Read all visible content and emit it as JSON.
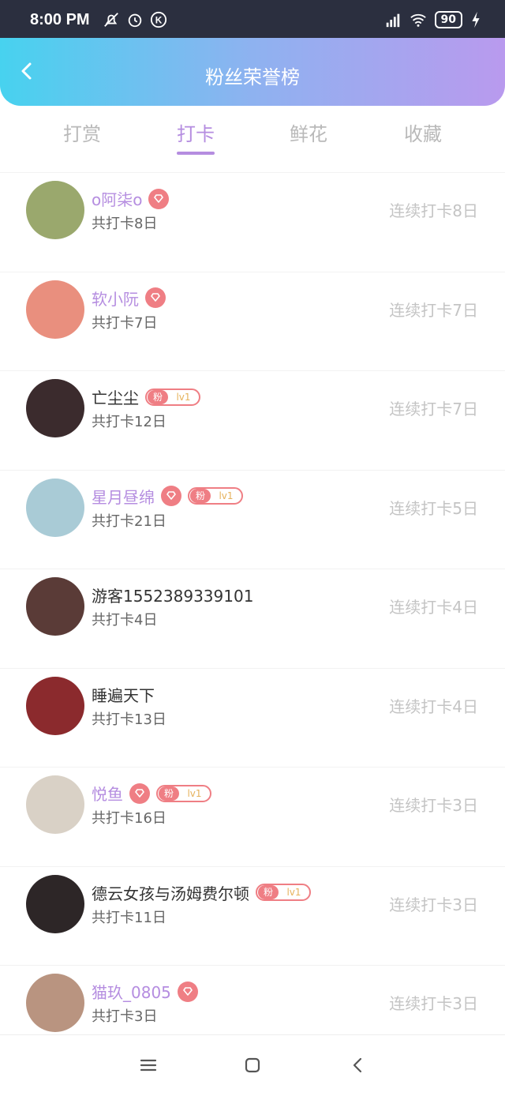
{
  "status": {
    "time": "8:00 PM",
    "battery": "90"
  },
  "header": {
    "title": "粉丝荣誉榜"
  },
  "tabs": [
    {
      "label": "打赏",
      "active": false
    },
    {
      "label": "打卡",
      "active": true
    },
    {
      "label": "鲜花",
      "active": false
    },
    {
      "label": "收藏",
      "active": false
    }
  ],
  "entries": [
    {
      "name": "o阿柒o",
      "purple": true,
      "diamond": true,
      "fan_badge": null,
      "total": "共打卡8日",
      "streak": "连续打卡8日",
      "avatar_color": "#9aa86d"
    },
    {
      "name": "软小阮",
      "purple": true,
      "diamond": true,
      "fan_badge": null,
      "total": "共打卡7日",
      "streak": "连续打卡7日",
      "avatar_color": "#e98f7e"
    },
    {
      "name": "亡尘尘",
      "purple": false,
      "diamond": false,
      "fan_badge": {
        "fan": "粉",
        "lv": "lv1"
      },
      "total": "共打卡12日",
      "streak": "连续打卡7日",
      "avatar_color": "#3b2b2d"
    },
    {
      "name": "星月昼绵",
      "purple": true,
      "diamond": true,
      "fan_badge": {
        "fan": "粉",
        "lv": "lv1"
      },
      "total": "共打卡21日",
      "streak": "连续打卡5日",
      "avatar_color": "#a9cbd6"
    },
    {
      "name": "游客1552389339101",
      "purple": false,
      "diamond": false,
      "fan_badge": null,
      "total": "共打卡4日",
      "streak": "连续打卡4日",
      "avatar_color": "#5a3b37"
    },
    {
      "name": "睡遍天下",
      "purple": false,
      "diamond": false,
      "fan_badge": null,
      "total": "共打卡13日",
      "streak": "连续打卡4日",
      "avatar_color": "#8b2a2d"
    },
    {
      "name": "悦鱼",
      "purple": true,
      "diamond": true,
      "fan_badge": {
        "fan": "粉",
        "lv": "lv1"
      },
      "total": "共打卡16日",
      "streak": "连续打卡3日",
      "avatar_color": "#d9d1c6"
    },
    {
      "name": "德云女孩与汤姆费尔顿",
      "purple": false,
      "diamond": false,
      "fan_badge": {
        "fan": "粉",
        "lv": "lv1"
      },
      "total": "共打卡11日",
      "streak": "连续打卡3日",
      "avatar_color": "#2d2627"
    },
    {
      "name": "猫玖_0805",
      "purple": true,
      "diamond": true,
      "fan_badge": null,
      "total": "共打卡3日",
      "streak": "连续打卡3日",
      "avatar_color": "#b99480"
    }
  ],
  "colors": {
    "accent": "#b58de0",
    "badge": "#ef7e84",
    "muted": "#c4c4c4"
  }
}
